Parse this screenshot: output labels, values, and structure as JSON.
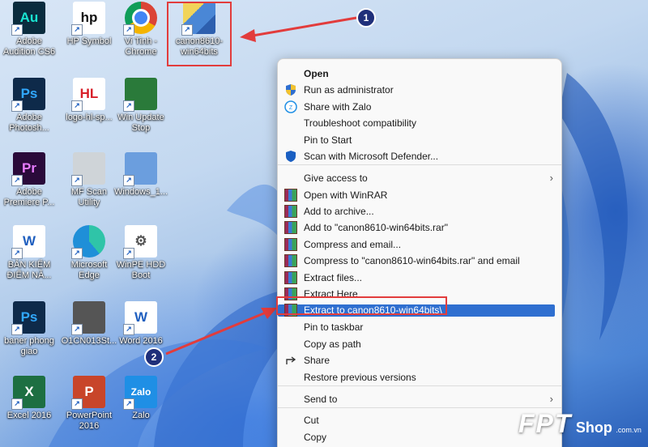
{
  "desktop_icons": [
    {
      "name": "adobe-audition-icon",
      "label": "Adobe Audition CS6",
      "glyph": "Au",
      "color": "#0a2c3e",
      "fg": "#19e3d0"
    },
    {
      "name": "hp-symbol-icon",
      "label": "HP Symbol",
      "glyph": "hp",
      "color": "#ffffff",
      "fg": "#111111"
    },
    {
      "name": "chrome-icon",
      "label": "Vi Tinh - Chrome",
      "glyph": "",
      "color": "#e8e8e8",
      "fg": "#ffffff"
    },
    {
      "name": "canon-installer-icon",
      "label": "canon8610-win64bits",
      "glyph": "",
      "color": "#4a87d6",
      "fg": "#ffffff"
    },
    {
      "name": "photoshop-icon",
      "label": "Adobe Photosh...",
      "glyph": "Ps",
      "color": "#0e2a4a",
      "fg": "#31a8ff"
    },
    {
      "name": "logo-hl-icon",
      "label": "logo-hl-sp...",
      "glyph": "HL",
      "color": "#ffffff",
      "fg": "#d8202a"
    },
    {
      "name": "win-update-stop-icon",
      "label": "Win Update Stop",
      "glyph": "",
      "color": "#2a7a3a",
      "fg": "#ffffff"
    },
    {
      "name": "premiere-icon",
      "label": "Adobe Premiere P...",
      "glyph": "Pr",
      "color": "#2a0a3a",
      "fg": "#e77cff"
    },
    {
      "name": "mf-scan-utility-icon",
      "label": "MF Scan Utility",
      "glyph": "",
      "color": "#cfd4d8",
      "fg": "#333333"
    },
    {
      "name": "windows-image-icon",
      "label": "Windows_1...",
      "glyph": "",
      "color": "#6b9ede",
      "fg": "#ffffff"
    },
    {
      "name": "word-doc-icon",
      "label": "BẢN KIỂM ĐIỂM NĂ...",
      "glyph": "W",
      "color": "#ffffff",
      "fg": "#1f5fbf"
    },
    {
      "name": "edge-icon",
      "label": "Microsoft Edge",
      "glyph": "",
      "color": "#1f8fd8",
      "fg": "#ffffff"
    },
    {
      "name": "winpe-hdd-boot-icon",
      "label": "WinPE HDD Boot",
      "glyph": "⚙",
      "color": "#ffffff",
      "fg": "#555555"
    },
    {
      "name": "psd-file-icon",
      "label": "baner phong giao",
      "glyph": "Ps",
      "color": "#0e2a4a",
      "fg": "#31a8ff"
    },
    {
      "name": "image-file-icon",
      "label": "O1CN013St...",
      "glyph": "",
      "color": "#555555",
      "fg": "#dddddd"
    },
    {
      "name": "word-2016-icon",
      "label": "Word 2016",
      "glyph": "W",
      "color": "#ffffff",
      "fg": "#1f5fbf"
    },
    {
      "name": "excel-2016-icon",
      "label": "Excel 2016",
      "glyph": "X",
      "color": "#1d6f42",
      "fg": "#ffffff"
    },
    {
      "name": "powerpoint-2016-icon",
      "label": "PowerPoint 2016",
      "glyph": "P",
      "color": "#c8452a",
      "fg": "#ffffff"
    },
    {
      "name": "zalo-icon",
      "label": "Zalo",
      "glyph": "Zalo",
      "color": "#1f8fe5",
      "fg": "#ffffff"
    }
  ],
  "context_menu": {
    "items": [
      {
        "label": "Open",
        "icon": "none",
        "bold": true
      },
      {
        "label": "Run as administrator",
        "icon": "shield"
      },
      {
        "label": "Share with Zalo",
        "icon": "zalo"
      },
      {
        "label": "Troubleshoot compatibility",
        "icon": "none"
      },
      {
        "label": "Pin to Start",
        "icon": "none"
      },
      {
        "label": "Scan with Microsoft Defender...",
        "icon": "defender"
      },
      {
        "label": "Give access to",
        "icon": "none",
        "submenu": true
      },
      {
        "label": "Open with WinRAR",
        "icon": "rar"
      },
      {
        "label": "Add to archive...",
        "icon": "rar"
      },
      {
        "label": "Add to \"canon8610-win64bits.rar\"",
        "icon": "rar"
      },
      {
        "label": "Compress and email...",
        "icon": "rar"
      },
      {
        "label": "Compress to \"canon8610-win64bits.rar\" and email",
        "icon": "rar"
      },
      {
        "label": "Extract files...",
        "icon": "rar"
      },
      {
        "label": "Extract Here",
        "icon": "rar"
      },
      {
        "label": "Extract to canon8610-win64bits\\",
        "icon": "rar",
        "highlighted": true
      },
      {
        "label": "Pin to taskbar",
        "icon": "none"
      },
      {
        "label": "Copy as path",
        "icon": "none"
      },
      {
        "label": "Share",
        "icon": "share"
      },
      {
        "label": "Restore previous versions",
        "icon": "none"
      },
      {
        "label": "Send to",
        "icon": "none",
        "submenu": true
      },
      {
        "label": "Cut",
        "icon": "none"
      },
      {
        "label": "Copy",
        "icon": "none"
      }
    ],
    "submenu_arrow": "›"
  },
  "annotations": {
    "step1": "1",
    "step2": "2"
  },
  "watermark": {
    "brand": "FPT",
    "shop": "Shop",
    "domain": ".com.vn"
  },
  "colors": {
    "highlight": "#2f6fd0",
    "callout": "#e23c3c",
    "badge": "#1f2f7a"
  }
}
